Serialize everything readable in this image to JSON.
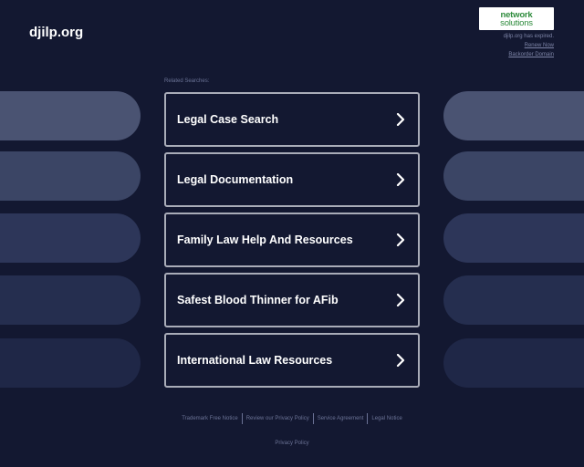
{
  "header": {
    "site_title": "djilp.org"
  },
  "registrar": {
    "logo_line1": "network",
    "logo_line2": "solutions",
    "expired_text": "djilp.org has expired.",
    "renew_label": "Renew Now",
    "backorder_label": "Backorder Domain"
  },
  "main": {
    "related_label": "Related Searches:",
    "searches": [
      {
        "label": "Legal Case Search"
      },
      {
        "label": "Legal Documentation"
      },
      {
        "label": "Family Law Help And Resources"
      },
      {
        "label": "Safest Blood Thinner for AFib"
      },
      {
        "label": "International Law Resources"
      }
    ]
  },
  "colors": {
    "background": "#131831",
    "pill_1": "#4a5372",
    "pill_2": "#3b4565",
    "pill_3": "#2d3659",
    "pill_4": "#252e4f",
    "pill_5": "#1f2747",
    "item_border": "#a9acb8"
  },
  "footer": {
    "links": [
      {
        "label": "Trademark Free Notice"
      },
      {
        "label": "Review our Privacy Policy"
      },
      {
        "label": "Service Agreement"
      },
      {
        "label": "Legal Notice"
      }
    ],
    "privacy_label": "Privacy Policy"
  }
}
